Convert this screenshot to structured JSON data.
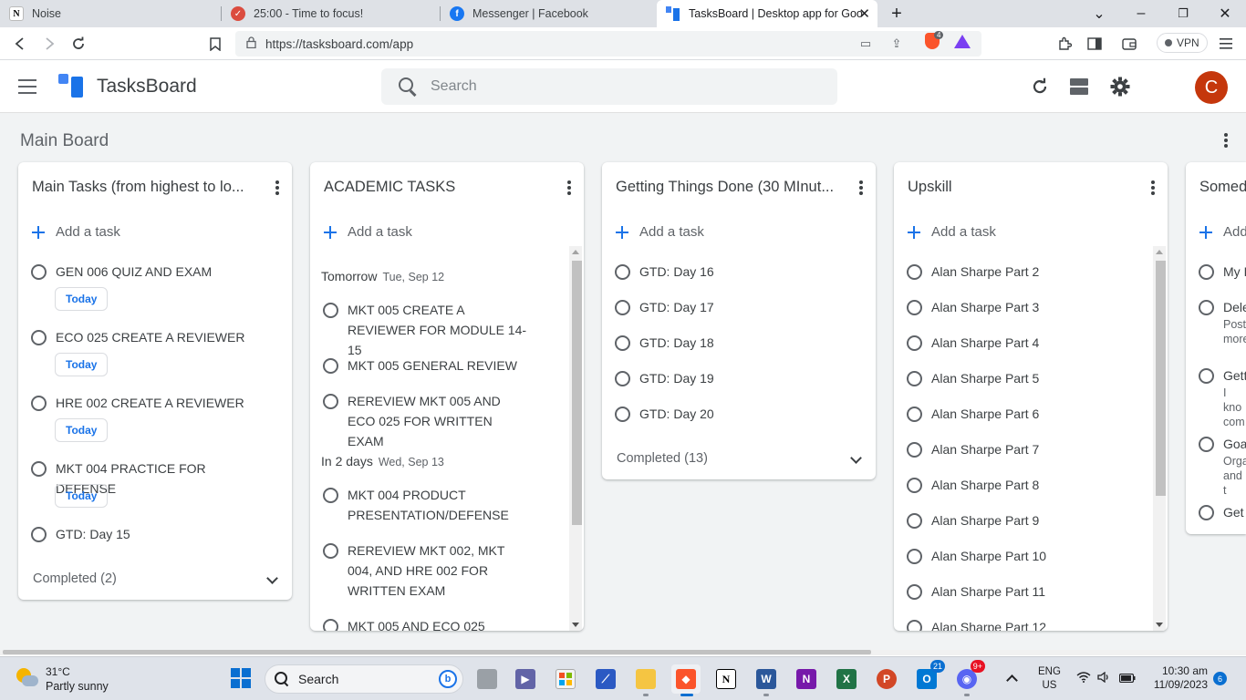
{
  "browser": {
    "tabs": [
      {
        "title": "Noise",
        "icon": "notion-icon",
        "color": "#000000"
      },
      {
        "title": "25:00 - Time to focus!",
        "icon": "check-circle-icon",
        "color": "#db4c3f"
      },
      {
        "title": "Messenger | Facebook",
        "icon": "facebook-icon",
        "color": "#1877f2"
      },
      {
        "title": "TasksBoard | Desktop app for Goo",
        "icon": "tasksboard-icon",
        "color": "#1a73e8",
        "active": true
      }
    ],
    "url": "https://tasksboard.com/app",
    "brave_badge": "4",
    "vpn_label": "VPN"
  },
  "app": {
    "name": "TasksBoard",
    "search_placeholder": "Search",
    "avatar_letter": "C",
    "avatar_color": "#c5370c",
    "accent": "#1a73e8"
  },
  "board": {
    "title": "Main Board",
    "add_task_label": "Add a task",
    "columns": [
      {
        "title": "Main Tasks (from highest to lo...",
        "tasks": [
          {
            "text": "GEN 006 QUIZ AND EXAM",
            "badge": "Today"
          },
          {
            "text": "ECO 025 CREATE A REVIEWER",
            "badge": "Today"
          },
          {
            "text": "HRE 002 CREATE A REVIEWER",
            "badge": "Today"
          },
          {
            "text": "MKT 004 PRACTICE FOR DEFENSE",
            "badge": "Today"
          },
          {
            "text": "GTD: Day 15"
          }
        ],
        "completed": "Completed (2)"
      },
      {
        "title": "ACADEMIC TASKS",
        "groups": [
          {
            "label": "Tomorrow",
            "date": "Tue, Sep 12",
            "tasks": [
              "MKT 005 CREATE A REVIEWER FOR MODULE 14-15",
              "MKT 005 GENERAL REVIEW",
              "REREVIEW MKT 005 AND ECO 025 FOR WRITTEN EXAM"
            ]
          },
          {
            "label": "In 2 days",
            "date": "Wed, Sep 13",
            "tasks": [
              "MKT 004 PRODUCT PRESENTATION/DEFENSE",
              "REREVIEW MKT 002, MKT 004, AND HRE 002 FOR WRITTEN EXAM",
              "MKT 005 AND ECO 025"
            ]
          }
        ]
      },
      {
        "title": "Getting Things Done (30 MInut...",
        "tasks": [
          "GTD: Day 16",
          "GTD: Day 17",
          "GTD: Day 18",
          "GTD: Day 19",
          "GTD: Day 20"
        ],
        "completed": "Completed (13)"
      },
      {
        "title": "Upskill",
        "tasks": [
          "Alan Sharpe Part 2",
          "Alan Sharpe Part 3",
          "Alan Sharpe Part 4",
          "Alan Sharpe Part 5",
          "Alan Sharpe Part 6",
          "Alan Sharpe Part 7",
          "Alan Sharpe Part 8",
          "Alan Sharpe Part 9",
          "Alan Sharpe Part 10",
          "Alan Sharpe Part 11",
          "Alan Sharpe Part 12"
        ]
      },
      {
        "title": "Somed",
        "add_label": "Add",
        "tasks": [
          {
            "text": "My I"
          },
          {
            "text": "Dele",
            "sub": "Post more"
          },
          {
            "text": "Gett",
            "sub": "I kno com"
          },
          {
            "text": "Goa",
            "sub": "Orga and t"
          },
          {
            "text": "Get"
          }
        ]
      }
    ]
  },
  "taskbar": {
    "temperature": "31°C",
    "condition": "Partly sunny",
    "search_label": "Search",
    "lang_top": "ENG",
    "lang_bottom": "US",
    "time": "10:30 am",
    "date": "11/09/2023",
    "notifications": "6",
    "badges": {
      "outlook": "21",
      "discord": "9+"
    }
  }
}
